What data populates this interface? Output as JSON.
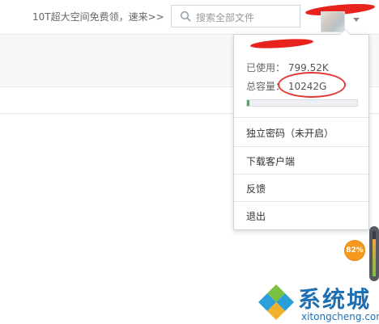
{
  "header": {
    "promo_text": "10T超大空间免费领，速来>>",
    "search_placeholder": "搜索全部文件"
  },
  "account_menu": {
    "used_label": "已使用：",
    "used_value": "799.52K",
    "total_label": "总容量：",
    "total_value": "10242G",
    "usage_fraction": 0.01,
    "items": [
      {
        "label": "独立密码（未开启）"
      },
      {
        "label": "下载客户端"
      },
      {
        "label": "反馈"
      },
      {
        "label": "退出"
      }
    ]
  },
  "overlay": {
    "percent_badge": "82%",
    "gauge_level": 0.82
  },
  "watermark": {
    "brand_cn": "系统城",
    "brand_en": "xitongcheng.com"
  },
  "colors": {
    "annotation_red": "#e8221d",
    "quota_green": "#39b54a",
    "badge_orange": "#f59a1b",
    "brand_blue": "#1f6fb3"
  }
}
